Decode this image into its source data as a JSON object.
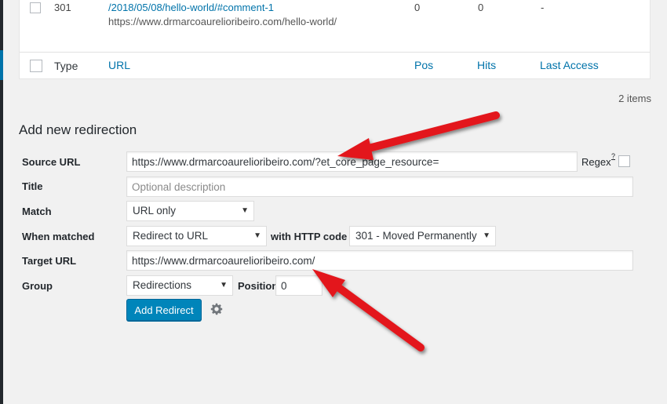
{
  "table": {
    "row": {
      "type": "301",
      "url_link": "/2018/05/08/hello-world/#comment-1",
      "target": "https://www.drmarcoaurelioribeiro.com/hello-world/",
      "pos": "0",
      "hits": "0",
      "last_access": "-"
    },
    "columns": {
      "type": "Type",
      "url": "URL",
      "pos": "Pos",
      "hits": "Hits",
      "last_access": "Last Access"
    },
    "items_count": "2 items"
  },
  "form": {
    "heading": "Add new redirection",
    "source_label": "Source URL",
    "source_value": "https://www.drmarcoaurelioribeiro.com/?et_core_page_resource=",
    "regex_label": "Regex",
    "regex_help": "?",
    "title_label": "Title",
    "title_placeholder": "Optional description",
    "match_label": "Match",
    "match_value": "URL only",
    "when_label": "When matched",
    "when_value": "Redirect to URL",
    "http_label": "with HTTP code",
    "http_value": "301 - Moved Permanently",
    "target_label": "Target URL",
    "target_value": "https://www.drmarcoaurelioribeiro.com/",
    "group_label": "Group",
    "group_value": "Redirections",
    "position_label": "Position",
    "position_value": "0",
    "submit_label": "Add Redirect"
  },
  "colors": {
    "accent": "#0073aa",
    "button": "#0085ba",
    "annotation_arrow": "#e3151a"
  }
}
